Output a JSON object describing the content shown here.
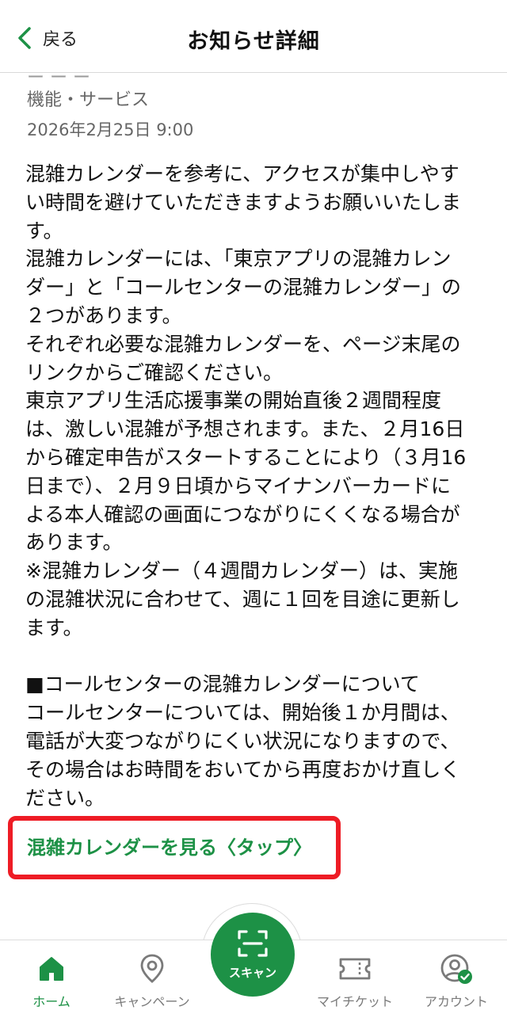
{
  "header": {
    "back_label": "戻る",
    "title": "お知らせ詳細"
  },
  "article": {
    "partial_title": "ー ー ー",
    "category": "機能・サービス",
    "date": "2026年2月25日 9:00",
    "lines": [
      "混雑カレンダーを参考に、アクセスが集中しやす",
      "い時間を避けていただきますようお願いいたしま",
      "す。",
      "混雑カレンダーには、「東京アプリの混雑カレン",
      "ダー」と「コールセンターの混雑カレンダー」の",
      "２つがあります。",
      "それぞれ必要な混雑カレンダーを、ページ末尾の",
      "リンクからご確認ください。",
      "東京アプリ生活応援事業の開始直後２週間程度",
      "は、激しい混雑が予想されます。また、２月16日",
      "から確定申告がスタートすることにより（３月16",
      "日まで）、２月９日頃からマイナンバーカードに",
      "よる本人確認の画面につながりにくくなる場合が",
      "あります。",
      "※混雑カレンダー（４週間カレンダー）は、実施",
      "の混雑状況に合わせて、週に１回を目途に更新し",
      "ます。"
    ],
    "callcenter_lines": [
      "■コールセンターの混雑カレンダーについて",
      "コールセンターについては、開始後１か月間は、",
      "電話が大変つながりにくい状況になりますので、",
      "その場合はお時間をおいてから再度おかけ直しく",
      "ださい。"
    ],
    "calendar_link": "混雑カレンダーを見る〈タップ〉"
  },
  "tabs": {
    "home": "ホーム",
    "campaign": "キャンペーン",
    "scan": "スキャン",
    "my_ticket": "マイチケット",
    "account": "アカウント"
  },
  "colors": {
    "accent": "#1d9146",
    "highlight_box": "#ee1c25",
    "inactive": "#7a7a7a"
  }
}
